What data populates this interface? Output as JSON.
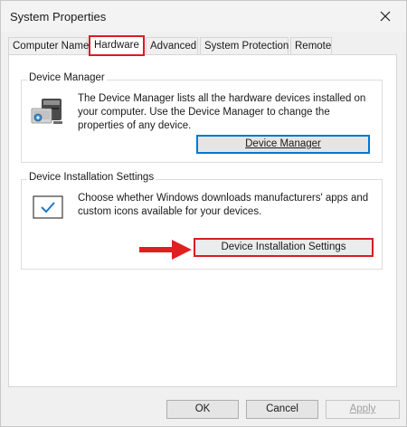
{
  "window": {
    "title": "System Properties"
  },
  "tabs": [
    {
      "label": "Computer Name"
    },
    {
      "label": "Hardware"
    },
    {
      "label": "Advanced"
    },
    {
      "label": "System Protection"
    },
    {
      "label": "Remote"
    }
  ],
  "device_manager": {
    "group_label": "Device Manager",
    "description": "The Device Manager lists all the hardware devices installed on your computer. Use the Device Manager to change the properties of any device.",
    "button_label": "Device Manager"
  },
  "device_installation": {
    "group_label": "Device Installation Settings",
    "description": "Choose whether Windows downloads manufacturers' apps and custom icons available for your devices.",
    "button_label": "Device Installation Settings"
  },
  "footer": {
    "ok_label": "OK",
    "cancel_label": "Cancel",
    "apply_label": "Apply"
  },
  "colors": {
    "highlight": "#d81c24",
    "accent": "#0078d4"
  }
}
